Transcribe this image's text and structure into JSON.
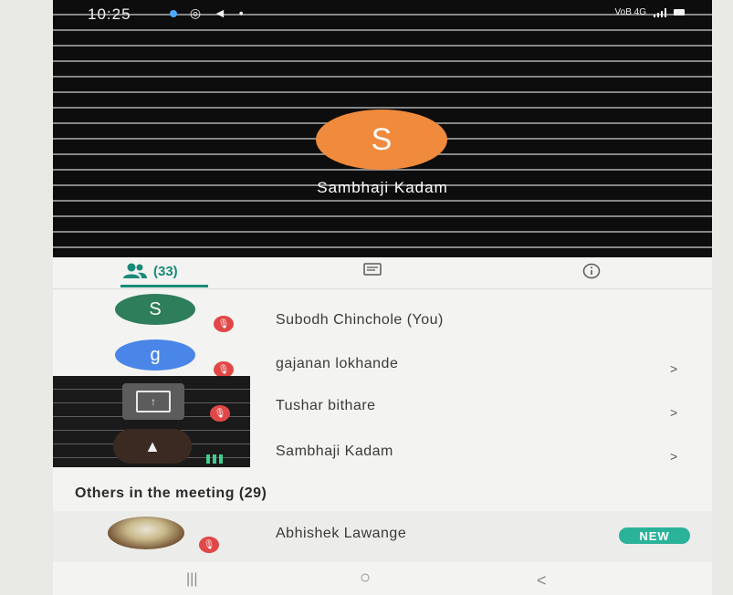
{
  "status_bar": {
    "time": "10:25",
    "network_label": "VoB 4G",
    "icons": [
      "notification-dot-icon",
      "whatsapp-icon",
      "telegram-icon",
      "dot-icon",
      "signal-icon",
      "battery-icon"
    ]
  },
  "video": {
    "speaker_initial": "S",
    "speaker_name": "Sambhaji Kadam",
    "avatar_color": "#f08a3c"
  },
  "tabs": {
    "people_count": "(33)",
    "active_color": "#1a8a7a"
  },
  "participants": [
    {
      "initial": "S",
      "name": "Subodh Chinchole (You)",
      "avatar_color": "#2e7d5b",
      "chevron": ""
    },
    {
      "initial": "g",
      "name": "gajanan lokhande",
      "avatar_color": "#4a86e8",
      "chevron": ">"
    },
    {
      "initial": "",
      "name": "Tushar bithare",
      "avatar_color": "",
      "chevron": ">"
    },
    {
      "initial": "",
      "name": "Sambhaji Kadam",
      "avatar_color": "",
      "chevron": ">"
    }
  ],
  "others": {
    "title": "Others in the meeting (29)",
    "items": [
      {
        "name": "Abhishek Lawange",
        "badge": "NEW",
        "badge_color": "#2bb39a"
      }
    ]
  },
  "nav": {
    "recents": "|||",
    "home": "○",
    "back": "<"
  }
}
